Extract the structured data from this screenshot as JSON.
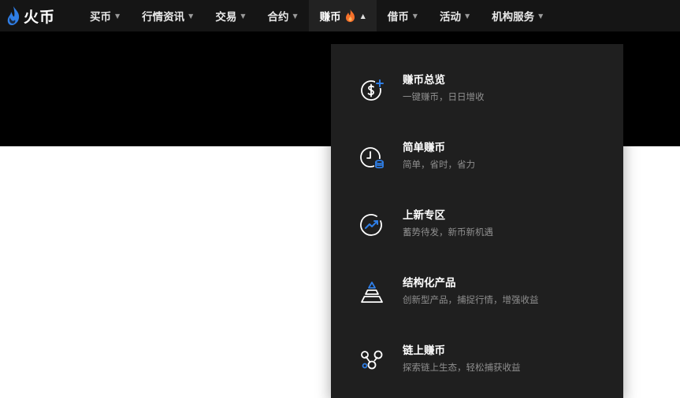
{
  "brand": {
    "name": "火币",
    "colors": {
      "navbar_bg": "#151515",
      "active_bg": "#222222",
      "dropdown_bg": "#1f1f1f",
      "accent_blue": "#2f7ee6",
      "flame_orange": "#f5702a"
    }
  },
  "nav": {
    "items": [
      {
        "label": "买币",
        "has_caret": true
      },
      {
        "label": "行情资讯",
        "has_caret": true
      },
      {
        "label": "交易",
        "has_caret": true
      },
      {
        "label": "合约",
        "has_caret": true
      },
      {
        "label": "赚币",
        "has_caret": true,
        "active": true,
        "icon": "flame-icon"
      },
      {
        "label": "借币",
        "has_caret": true
      },
      {
        "label": "活动",
        "has_caret": true
      },
      {
        "label": "机构服务",
        "has_caret": true
      }
    ]
  },
  "dropdown": {
    "items": [
      {
        "title": "赚币总览",
        "subtitle": "一键赚币，日日增收",
        "icon": "coin-plus-icon"
      },
      {
        "title": "简单赚币",
        "subtitle": "简单，省时，省力",
        "icon": "clock-coins-icon"
      },
      {
        "title": "上新专区",
        "subtitle": "蓄势待发，新币新机遇",
        "icon": "trend-up-icon"
      },
      {
        "title": "结构化产品",
        "subtitle": "创新型产品，捕捉行情，增强收益",
        "icon": "pyramid-icon"
      },
      {
        "title": "链上赚币",
        "subtitle": "探索链上生态，轻松捕获收益",
        "icon": "chain-nodes-icon"
      }
    ]
  }
}
